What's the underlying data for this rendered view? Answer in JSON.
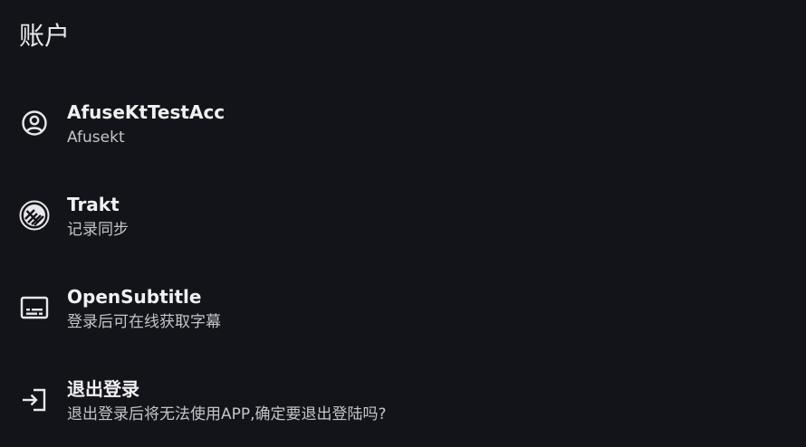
{
  "header": {
    "title": "账户"
  },
  "items": [
    {
      "icon": "account-circle-icon",
      "title": "AfuseKtTestAcc",
      "subtitle": "Afusekt"
    },
    {
      "icon": "trakt-logo-icon",
      "title": "Trakt",
      "subtitle": "记录同步"
    },
    {
      "icon": "subtitles-icon",
      "title": "OpenSubtitle",
      "subtitle": "登录后可在线获取字幕"
    },
    {
      "icon": "logout-icon",
      "title": "退出登录",
      "subtitle": "退出登录后将无法使用APP,确定要退出登陆吗?"
    }
  ],
  "colors": {
    "background": "#131419",
    "primary_text": "#f0f0f2",
    "secondary_text": "#c4c5c9"
  }
}
